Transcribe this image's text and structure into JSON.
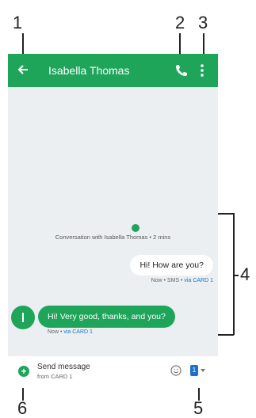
{
  "callouts": {
    "n1": "1",
    "n2": "2",
    "n3": "3",
    "n4": "4",
    "n5": "5",
    "n6": "6"
  },
  "appbar": {
    "title": "Isabella Thomas",
    "back_icon": "arrow-back-icon",
    "call_icon": "phone-icon",
    "more_icon": "more-vert-icon",
    "color": "#1fa55a"
  },
  "conversation": {
    "info": "Conversation with Isabella Thomas • 2 mins",
    "outgoing": {
      "text": "Hi! How are you?",
      "meta_prefix": "Now • SMS • ",
      "meta_via": "via CARD 1"
    },
    "incoming": {
      "text": "Hi! Very good, thanks, and you?",
      "meta_prefix": "Now • ",
      "meta_via": "via CARD 1"
    }
  },
  "compose": {
    "title": "Send message",
    "subtitle": "from CARD 1",
    "add_icon": "add-icon",
    "emoji_icon": "emoji-icon",
    "sim_label": "1"
  }
}
